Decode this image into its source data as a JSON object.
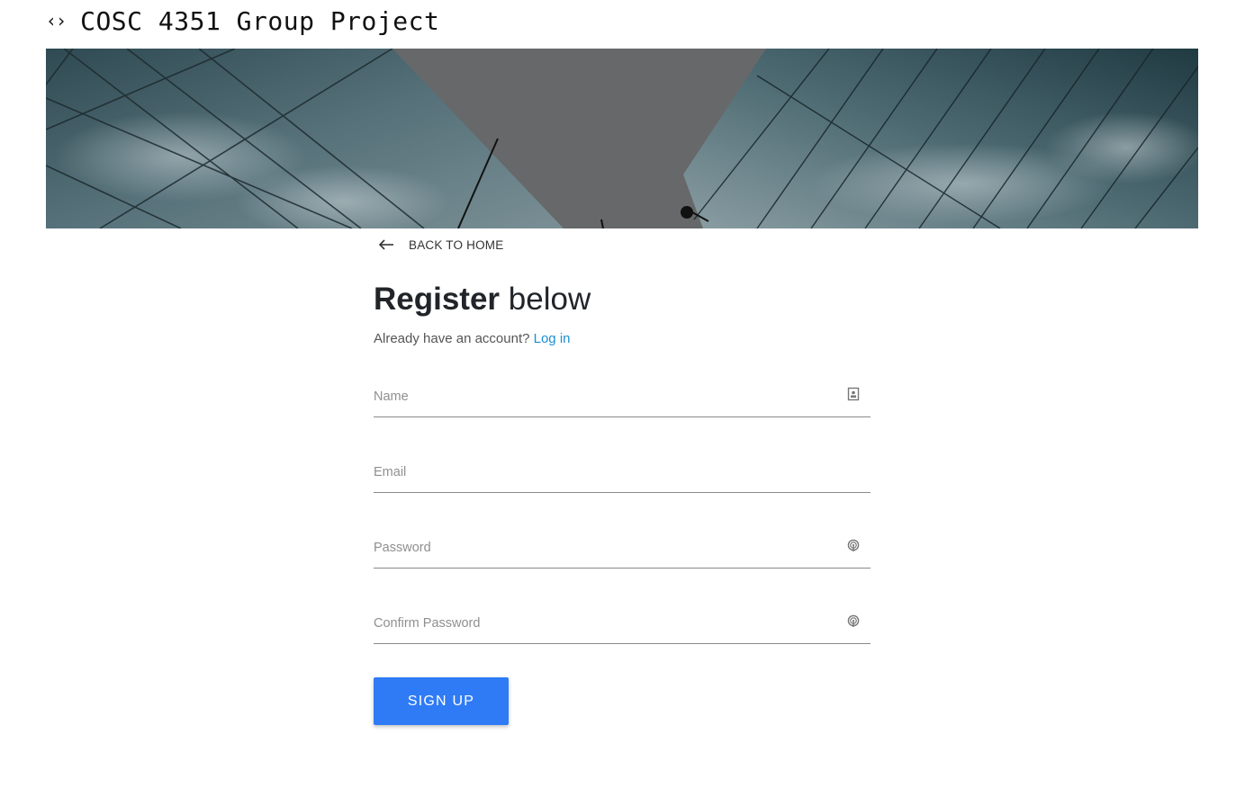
{
  "header": {
    "icon": "code-brackets-icon",
    "icon_glyph": "‹›",
    "title": "COSC 4351 Group Project"
  },
  "banner": {
    "image": "glass-skyscrapers-looking-up"
  },
  "back_link": {
    "icon": "arrow-left-icon",
    "label": "BACK TO HOME"
  },
  "form": {
    "title_strong": "Register",
    "title_rest": " below",
    "subtitle_text": "Already have an account? ",
    "login_link": "Log in",
    "fields": [
      {
        "name": "name",
        "placeholder": "Name",
        "value": "",
        "icon": "id-badge-icon"
      },
      {
        "name": "email",
        "placeholder": "Email",
        "value": "",
        "icon": ""
      },
      {
        "name": "password",
        "placeholder": "Password",
        "value": "",
        "icon": "fingerprint-icon"
      },
      {
        "name": "confirm_password",
        "placeholder": "Confirm Password",
        "value": "",
        "icon": "fingerprint-icon"
      }
    ],
    "submit_label": "SIGN UP"
  },
  "colors": {
    "accent": "#2f7bf6",
    "link": "#1b8fd3"
  }
}
